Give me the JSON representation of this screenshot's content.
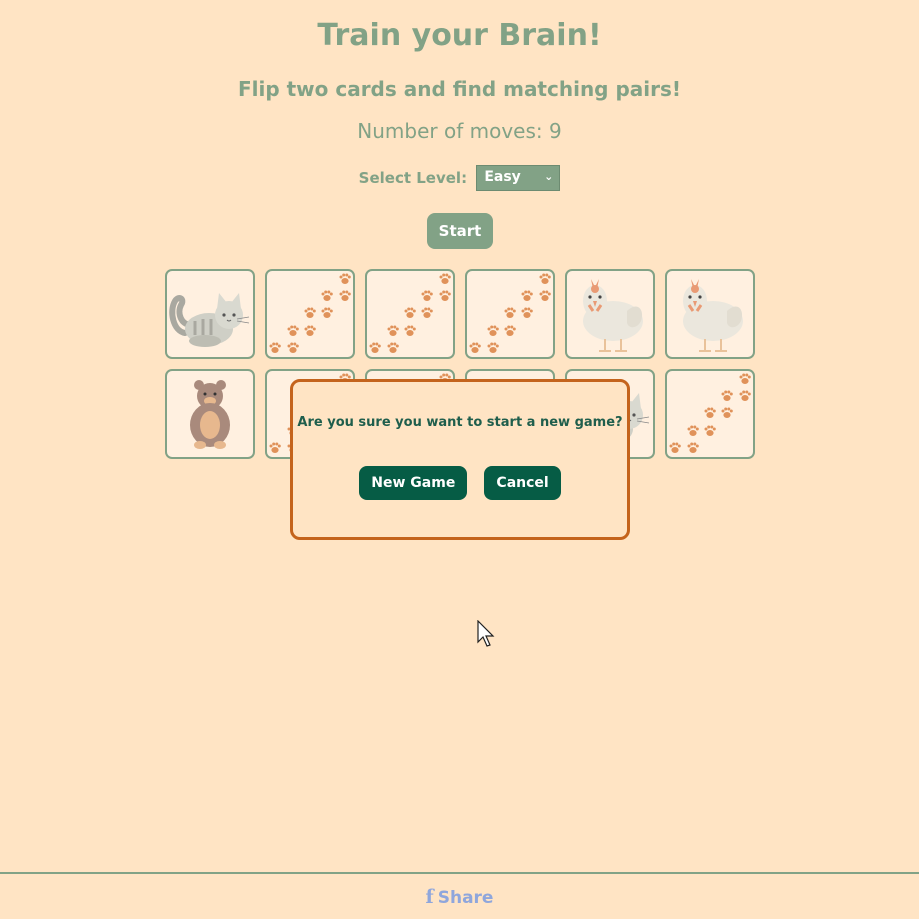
{
  "header": {
    "title": "Train your Brain!",
    "subtitle": "Flip two cards and find matching pairs!",
    "moves_label": "Number of moves: 9"
  },
  "controls": {
    "level_label": "Select Level:",
    "level_value": "Easy",
    "start_label": "Start"
  },
  "board": {
    "cards": [
      {
        "face": "cat",
        "state": "revealed"
      },
      {
        "face": "paw-prints",
        "state": "hidden"
      },
      {
        "face": "paw-prints",
        "state": "hidden"
      },
      {
        "face": "paw-prints",
        "state": "hidden"
      },
      {
        "face": "chicken",
        "state": "revealed"
      },
      {
        "face": "chicken",
        "state": "revealed"
      },
      {
        "face": "bear",
        "state": "revealed"
      },
      {
        "face": "paw-prints",
        "state": "hidden"
      },
      {
        "face": "paw-prints",
        "state": "hidden"
      },
      {
        "face": "unknown",
        "state": "covered"
      },
      {
        "face": "cat",
        "state": "revealed"
      },
      {
        "face": "paw-prints",
        "state": "hidden"
      }
    ]
  },
  "dialog": {
    "message": "Are you sure you want to start a new game?",
    "confirm_label": "New Game",
    "cancel_label": "Cancel"
  },
  "footer": {
    "share_label": "Share",
    "share_icon": "facebook-icon"
  },
  "colors": {
    "background": "#ffe4c4",
    "accent": "#82a286",
    "dialog_border": "#c4631c",
    "dialog_button": "#065c45",
    "share": "#8fa6dc",
    "paw": "#e0925a"
  }
}
